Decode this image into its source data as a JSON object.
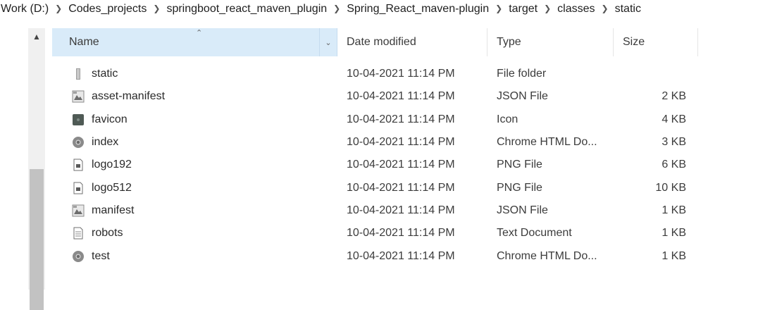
{
  "breadcrumb": [
    "Work (D:)",
    "Codes_projects",
    "springboot_react_maven_plugin",
    "Spring_React_maven-plugin",
    "target",
    "classes",
    "static"
  ],
  "columns": {
    "name": "Name",
    "date": "Date modified",
    "type": "Type",
    "size": "Size"
  },
  "files": [
    {
      "name": "static",
      "date": "10-04-2021 11:14 PM",
      "type": "File folder",
      "size": "",
      "icon": "folder-icon"
    },
    {
      "name": "asset-manifest",
      "date": "10-04-2021 11:14 PM",
      "type": "JSON File",
      "size": "2 KB",
      "icon": "json-file-icon"
    },
    {
      "name": "favicon",
      "date": "10-04-2021 11:14 PM",
      "type": "Icon",
      "size": "4 KB",
      "icon": "ico-file-icon"
    },
    {
      "name": "index",
      "date": "10-04-2021 11:14 PM",
      "type": "Chrome HTML Do...",
      "size": "3 KB",
      "icon": "chrome-html-icon"
    },
    {
      "name": "logo192",
      "date": "10-04-2021 11:14 PM",
      "type": "PNG File",
      "size": "6 KB",
      "icon": "png-file-icon"
    },
    {
      "name": "logo512",
      "date": "10-04-2021 11:14 PM",
      "type": "PNG File",
      "size": "10 KB",
      "icon": "png-file-icon"
    },
    {
      "name": "manifest",
      "date": "10-04-2021 11:14 PM",
      "type": "JSON File",
      "size": "1 KB",
      "icon": "json-file-icon"
    },
    {
      "name": "robots",
      "date": "10-04-2021 11:14 PM",
      "type": "Text Document",
      "size": "1 KB",
      "icon": "text-file-icon"
    },
    {
      "name": "test",
      "date": "10-04-2021 11:14 PM",
      "type": "Chrome HTML Do...",
      "size": "1 KB",
      "icon": "chrome-html-icon"
    }
  ]
}
